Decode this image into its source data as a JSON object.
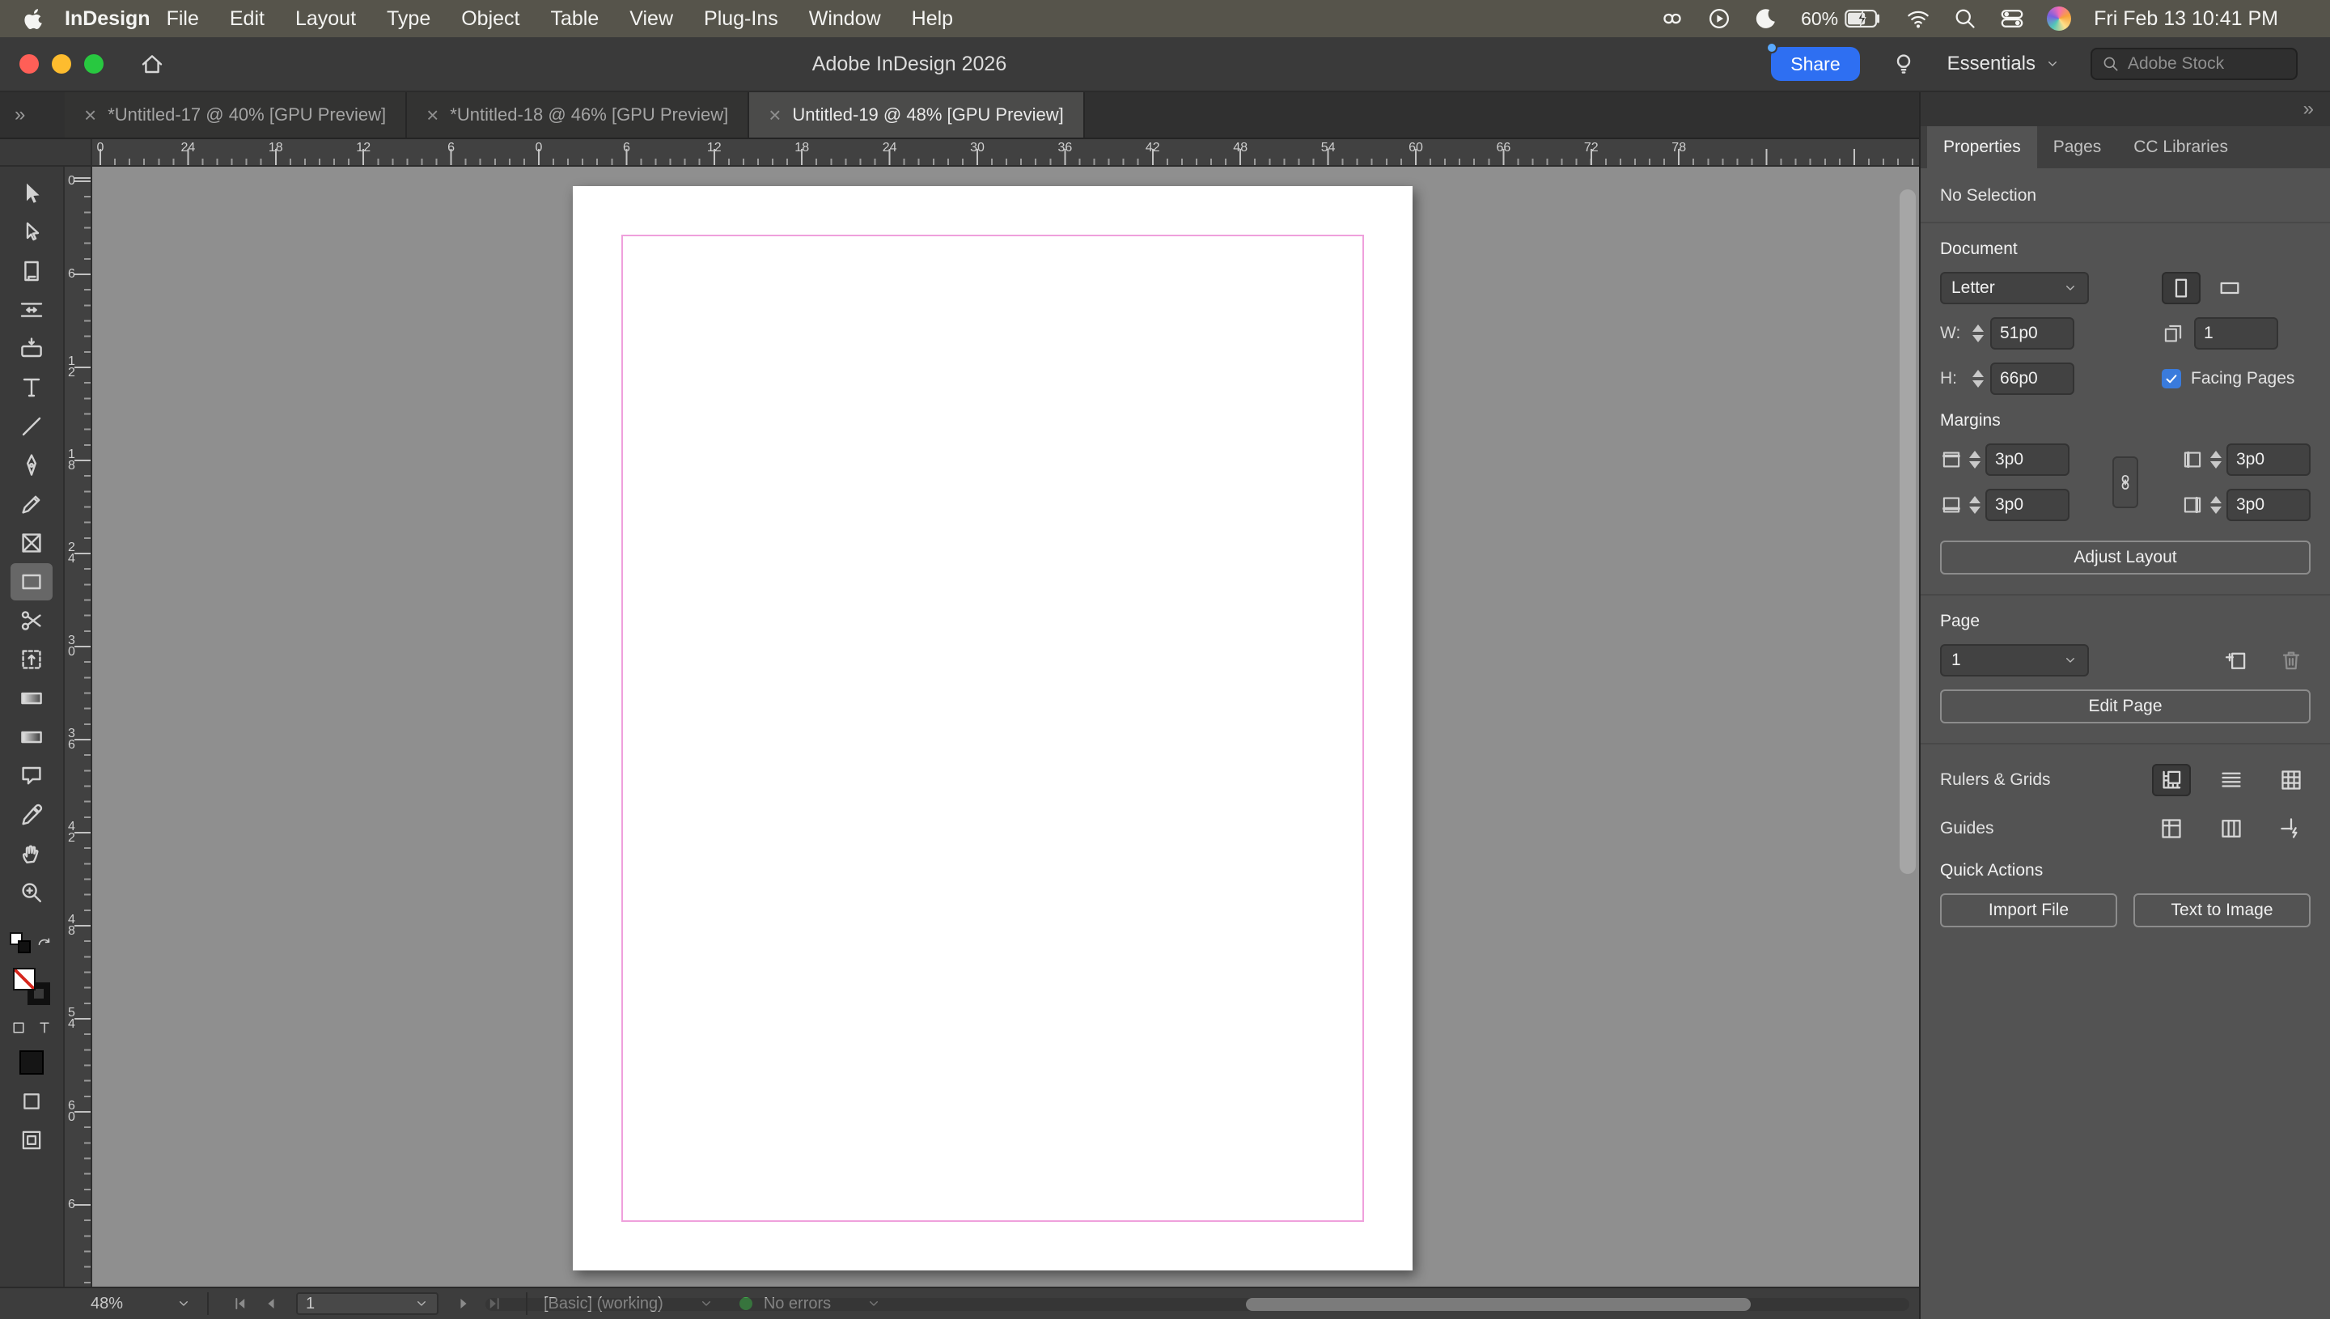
{
  "menubar": {
    "app_name": "InDesign",
    "items": [
      "File",
      "Edit",
      "Layout",
      "Type",
      "Object",
      "Table",
      "View",
      "Plug-Ins",
      "Window",
      "Help"
    ],
    "battery": "60%",
    "clock": "Fri Feb 13  10:41 PM"
  },
  "titlebar": {
    "title": "Adobe InDesign 2026",
    "share": "Share",
    "workspace": "Essentials",
    "stock_search": "Adobe Stock"
  },
  "tabs": [
    {
      "label": "*Untitled-17 @ 40% [GPU Preview]",
      "active": false
    },
    {
      "label": "*Untitled-18 @ 46% [GPU Preview]",
      "active": false
    },
    {
      "label": "Untitled-19 @ 48% [GPU Preview]",
      "active": true
    }
  ],
  "rulers": {
    "horizontal": [
      "0",
      "24",
      "18",
      "12",
      "6",
      "0",
      "6",
      "12",
      "18",
      "24",
      "30",
      "36",
      "42",
      "48",
      "54",
      "60",
      "66",
      "72",
      "78"
    ],
    "vertical": [
      "0",
      "6",
      "12",
      "18",
      "24",
      "30",
      "36",
      "42",
      "48",
      "54",
      "60",
      "6"
    ]
  },
  "tools": [
    "selection",
    "direct-selection",
    "page",
    "gap",
    "content-collector",
    "type",
    "line",
    "pen",
    "pencil",
    "frame",
    "rectangle",
    "scissors",
    "free-transform",
    "gradient",
    "gradient-feather",
    "note",
    "eyedropper",
    "hand",
    "zoom"
  ],
  "selected_tool": "rectangle",
  "panel": {
    "tabs": [
      "Properties",
      "Pages",
      "CC Libraries"
    ],
    "active_tab": "Properties",
    "no_selection": "No Selection",
    "document": {
      "title": "Document",
      "page_size": "Letter",
      "w_label": "W:",
      "w": "51p0",
      "h_label": "H:",
      "h": "66p0",
      "pages": "1",
      "facing_pages": "Facing Pages"
    },
    "margins": {
      "title": "Margins",
      "top": "3p0",
      "bottom": "3p0",
      "inside": "3p0",
      "outside": "3p0"
    },
    "adjust_layout": "Adjust Layout",
    "page": {
      "title": "Page",
      "current": "1",
      "edit": "Edit Page"
    },
    "rulers_grids": "Rulers & Grids",
    "guides": "Guides",
    "quick_actions": {
      "title": "Quick Actions",
      "import_file": "Import File",
      "text_to_image": "Text to Image"
    }
  },
  "statusbar": {
    "zoom": "48%",
    "page": "1",
    "preflight_profile": "[Basic] (working)",
    "preflight_status": "No errors"
  }
}
